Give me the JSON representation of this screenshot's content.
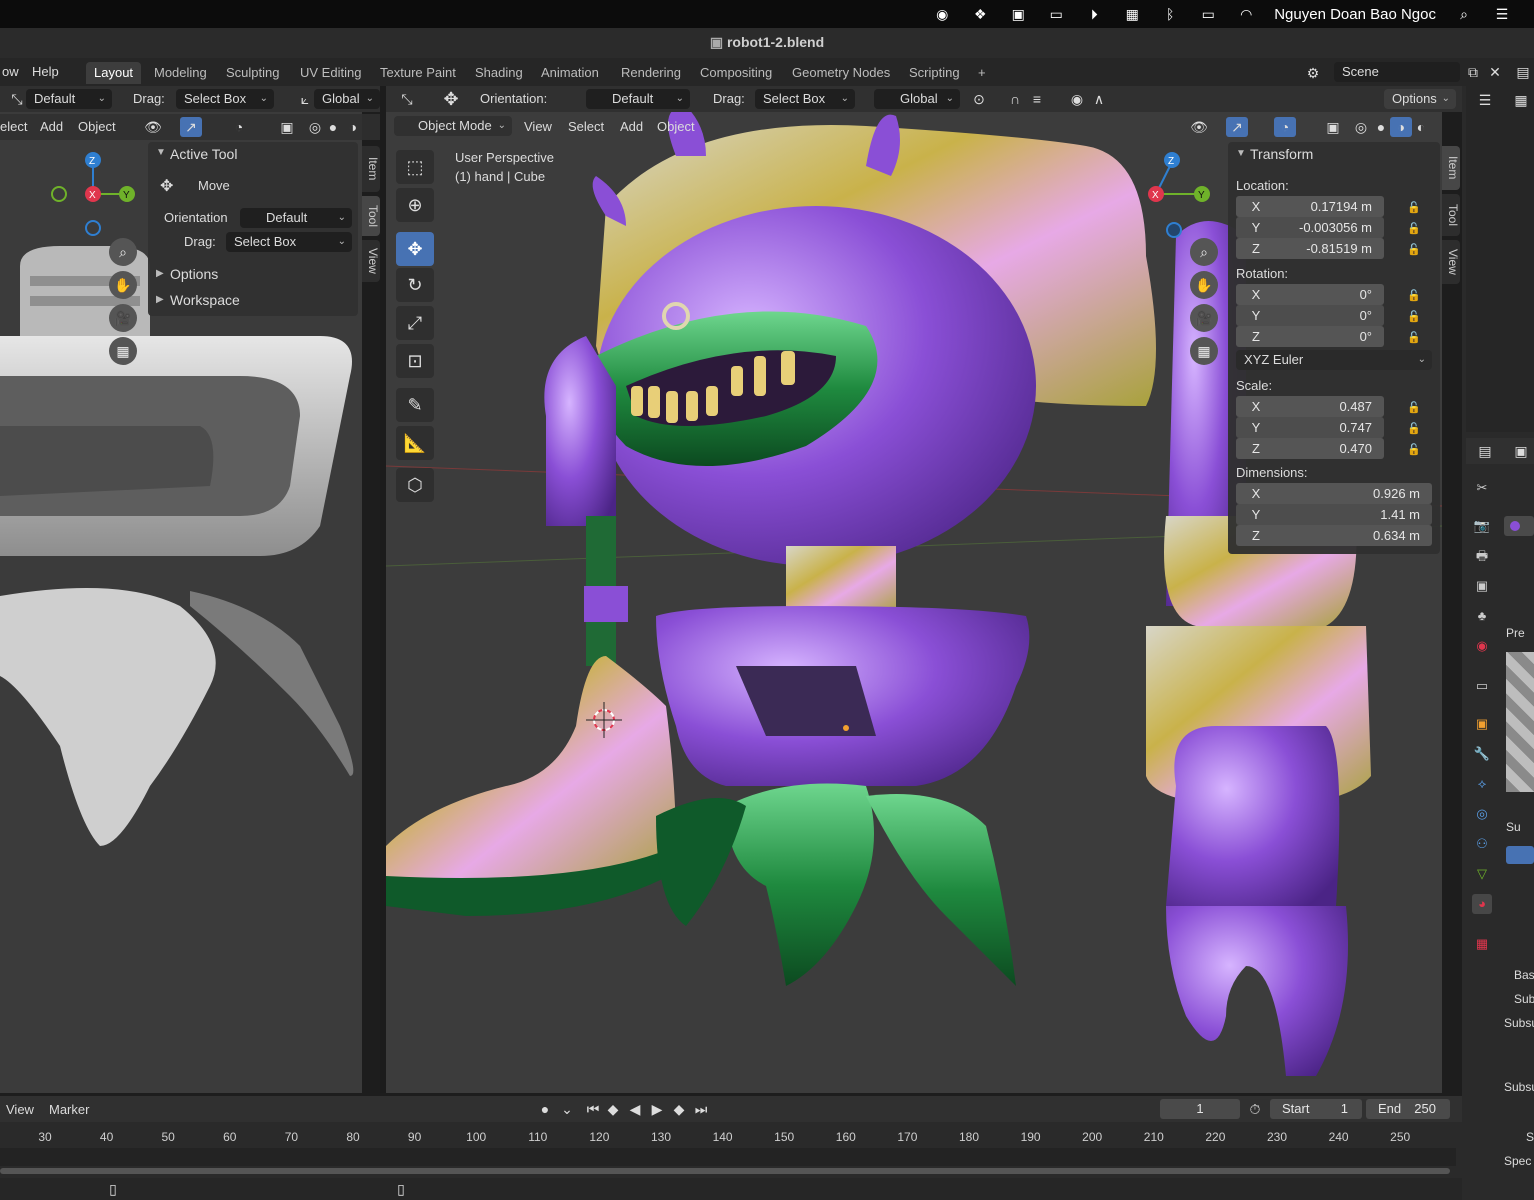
{
  "macbar": {
    "user": "Nguyen Doan Bao Ngoc"
  },
  "window": {
    "title": "robot1-2.blend"
  },
  "menus": {
    "file_partial": "ow",
    "help": "Help"
  },
  "workspaces": [
    "Layout",
    "Modeling",
    "Sculpting",
    "UV Editing",
    "Texture Paint",
    "Shading",
    "Animation",
    "Rendering",
    "Compositing",
    "Geometry Nodes",
    "Scripting"
  ],
  "workspace_add": "+",
  "scene": {
    "name": "Scene"
  },
  "left_header": {
    "orientation_value": "Default",
    "drag_label": "Drag:",
    "drag_value": "Select Box",
    "transform_value": "Global"
  },
  "left_menu": {
    "select_partial": "elect",
    "add": "Add",
    "object": "Object"
  },
  "tool_panel": {
    "active_tool": "Active Tool",
    "move": "Move",
    "orientation_label": "Orientation",
    "orientation_value": "Default",
    "drag_label": "Drag:",
    "drag_value": "Select Box",
    "options": "Options",
    "workspace": "Workspace"
  },
  "sidetabs_left": [
    "Item",
    "Tool",
    "View"
  ],
  "vp_header": {
    "orientation_label": "Orientation:",
    "orientation_value": "Default",
    "drag_label": "Drag:",
    "drag_value": "Select Box",
    "transform_value": "Global",
    "options": "Options"
  },
  "vp_menu": {
    "mode": "Object Mode",
    "view": "View",
    "select": "Select",
    "add": "Add",
    "object": "Object"
  },
  "overlay": {
    "perspective": "User Perspective",
    "context": "(1) hand | Cube"
  },
  "transform": {
    "title": "Transform",
    "location_label": "Location:",
    "location": [
      {
        "axis": "X",
        "value": "0.17194 m"
      },
      {
        "axis": "Y",
        "value": "-0.003056 m"
      },
      {
        "axis": "Z",
        "value": "-0.81519 m"
      }
    ],
    "rotation_label": "Rotation:",
    "rotation": [
      {
        "axis": "X",
        "value": "0°"
      },
      {
        "axis": "Y",
        "value": "0°"
      },
      {
        "axis": "Z",
        "value": "0°"
      }
    ],
    "rotation_mode": "XYZ Euler",
    "scale_label": "Scale:",
    "scale": [
      {
        "axis": "X",
        "value": "0.487"
      },
      {
        "axis": "Y",
        "value": "0.747"
      },
      {
        "axis": "Z",
        "value": "0.470"
      }
    ],
    "dimensions_label": "Dimensions:",
    "dimensions": [
      {
        "axis": "X",
        "value": "0.926 m"
      },
      {
        "axis": "Y",
        "value": "1.41 m"
      },
      {
        "axis": "Z",
        "value": "0.634 m"
      }
    ]
  },
  "sidetabs_right": [
    "Item",
    "Tool",
    "View"
  ],
  "gizmo": {
    "z": "Z",
    "y": "Y",
    "x": "X"
  },
  "timeline": {
    "view": "View",
    "marker": "Marker",
    "current_frame": "1",
    "start_label": "Start",
    "start": "1",
    "end_label": "End",
    "end": "250",
    "ticks": [
      "30",
      "40",
      "50",
      "60",
      "70",
      "80",
      "90",
      "100",
      "110",
      "120",
      "130",
      "140",
      "150",
      "160",
      "170",
      "180",
      "190",
      "200",
      "210",
      "220",
      "230",
      "240",
      "250"
    ]
  },
  "props_partial": {
    "pre": "Pre",
    "sub": "Su",
    "bas": "Bas",
    "subs1": "Sub",
    "subs2": "Subsu",
    "subs3": "Subsu",
    "s": "S",
    "spec": "Spec"
  },
  "colors": {
    "accent": "#4772b3",
    "x_axis": "#e0364d",
    "y_axis": "#6fb22a",
    "z_axis": "#2f7fd1",
    "purple": "#8a4fd6",
    "green": "#1f8a3f",
    "gold": "#c9b24a"
  }
}
